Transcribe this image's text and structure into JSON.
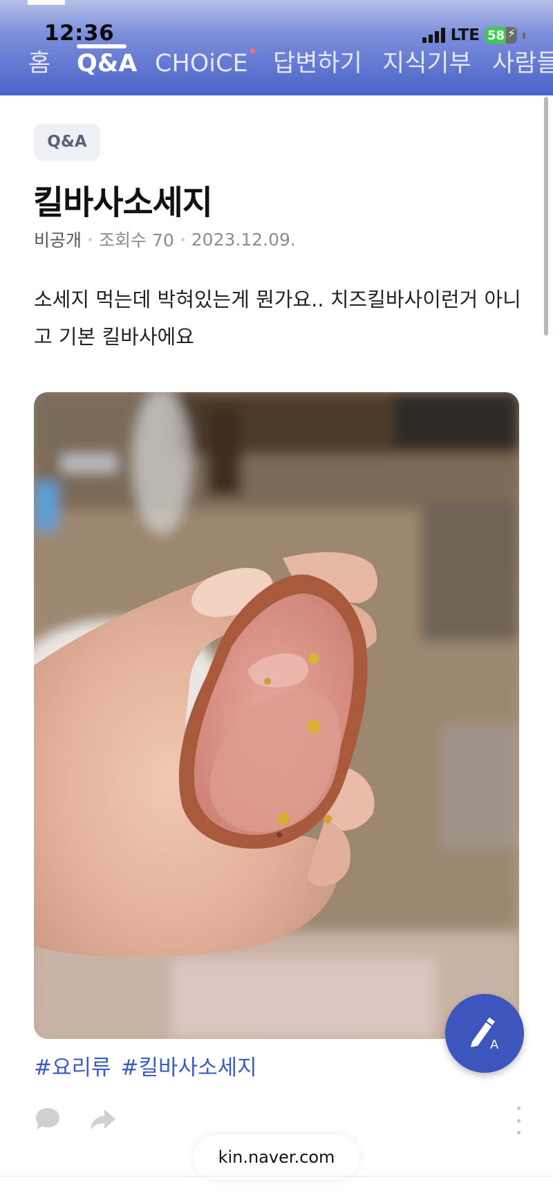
{
  "status_bar": {
    "time": "12:36",
    "network": "LTE",
    "battery": "58"
  },
  "tabs": [
    {
      "label": "홈"
    },
    {
      "label": "Q&A"
    },
    {
      "label": "CHOiCE"
    },
    {
      "label": "답변하기"
    },
    {
      "label": "지식기부"
    },
    {
      "label": "사람들"
    }
  ],
  "post": {
    "category": "Q&A",
    "title": "킬바사소세지",
    "author": "비공개",
    "views": "조회수 70",
    "date": "2023.12.09.",
    "body": "소세지 먹는데 박혀있는게 뭔가요.. 치즈킬바사이런거 아니고 기본 킬바사에요",
    "tags": [
      "#요리류",
      "#킬바사소세지"
    ]
  },
  "browser": {
    "url": "kin.naver.com"
  },
  "colors": {
    "header_top": "#b6c0e6",
    "header_bottom": "#4a63c7",
    "accent": "#3b5bc7",
    "fab": "#3d56bd"
  },
  "icons": {
    "fab": "write-answer-icon",
    "comment": "comment-icon",
    "share": "share-icon",
    "more": "more-vertical-icon"
  }
}
